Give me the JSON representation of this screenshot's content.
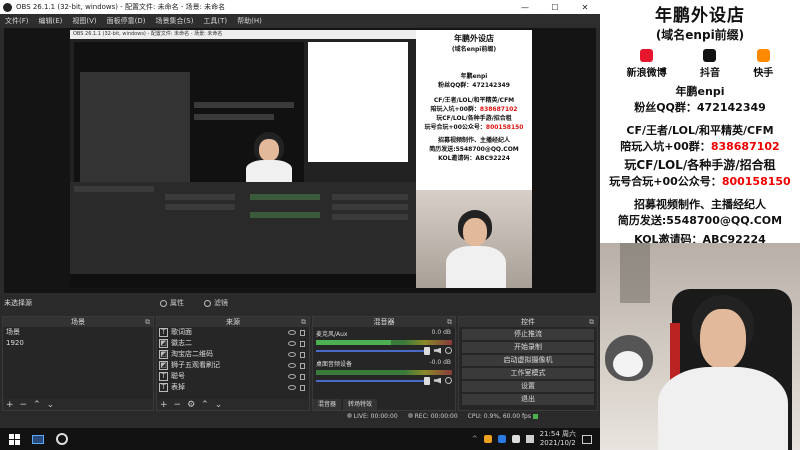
{
  "window": {
    "title": "OBS 26.1.1 (32-bit, windows) - 配置文件: 未命名 - 场景: 未命名",
    "minimize": "—",
    "maximize": "☐",
    "close": "✕"
  },
  "menu": [
    "文件(F)",
    "编辑(E)",
    "视图(V)",
    "面板停靠(D)",
    "场景集合(S)",
    "工具(T)",
    "帮助(H)"
  ],
  "docks": {
    "no_source": "未选择源",
    "properties": "属性",
    "filters": "滤镜",
    "scenes": {
      "header": "场景",
      "items": [
        "场景",
        "1920"
      ]
    },
    "sources": {
      "header": "来源",
      "items": [
        {
          "icon": "text-icon",
          "label": "歌词面"
        },
        {
          "icon": "image-icon",
          "label": "徽志二"
        },
        {
          "icon": "image-icon",
          "label": "淘宝店二维码"
        },
        {
          "icon": "image-icon",
          "label": "狮子五观看刷记"
        },
        {
          "icon": "text-icon",
          "label": "聪号"
        },
        {
          "icon": "text-icon",
          "label": "表掉"
        }
      ]
    },
    "mixer": {
      "header": "混音器",
      "channels": [
        {
          "name": "麦克风/Aux",
          "db": "0.0 dB",
          "level": 0.55
        },
        {
          "name": "桌面音频设备",
          "db": "-0.0 dB",
          "level": 0.0
        }
      ],
      "tabs": [
        "混音器",
        "转场特效"
      ]
    },
    "controls": {
      "header": "控件",
      "buttons": [
        "停止推流",
        "开始录制",
        "启动虚拟摄像机",
        "工作室模式",
        "设置",
        "退出"
      ]
    }
  },
  "status": {
    "live": "LIVE: 00:00:00",
    "rec": "REC: 00:00:00",
    "cpu": "CPU: 0.9%, 60.00 fps"
  },
  "taskbar": {
    "time": "21:54 周六",
    "date": "2021/10/2"
  },
  "overlay": {
    "title": "年鹏外设店",
    "subtitle": "(域名enpi前缀)",
    "social": [
      {
        "label": "新浪微博",
        "icon": "weibo-icon",
        "color": "#e6162d"
      },
      {
        "label": "抖音",
        "icon": "douyin-icon",
        "color": "#111111"
      },
      {
        "label": "快手",
        "icon": "kuaishou-icon",
        "color": "#ff8a00"
      }
    ],
    "streamer": "年鹏enpi",
    "fan_group": "粉丝QQ群：472142349",
    "line1": "CF/王者/LOL/和平精英/CFM",
    "line2_prefix": "陪玩入坑+00群：",
    "line2_red": "838687102",
    "line3": "玩CF/LOL/各种手游/招合租",
    "line4_prefix": "玩号合玩+00公众号：",
    "line4_red": "800158150",
    "line5": "招募视频制作、主播经纪人",
    "line6": "简历发送:5548700@QQ.COM",
    "line7": "KOL邀请码：ABC92224"
  }
}
